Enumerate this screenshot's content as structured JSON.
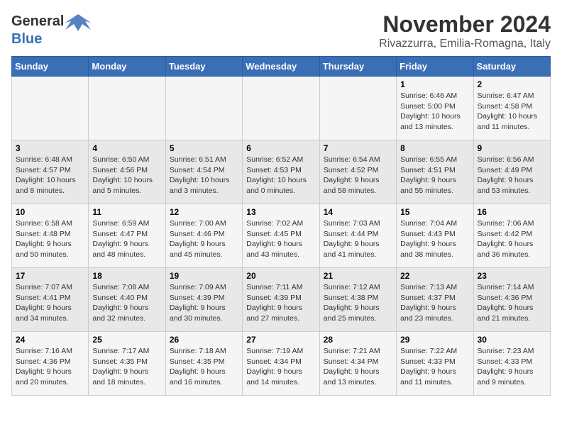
{
  "header": {
    "logo_general": "General",
    "logo_blue": "Blue",
    "month_title": "November 2024",
    "location": "Rivazzurra, Emilia-Romagna, Italy"
  },
  "days_of_week": [
    "Sunday",
    "Monday",
    "Tuesday",
    "Wednesday",
    "Thursday",
    "Friday",
    "Saturday"
  ],
  "weeks": [
    {
      "days": [
        {
          "num": "",
          "info": ""
        },
        {
          "num": "",
          "info": ""
        },
        {
          "num": "",
          "info": ""
        },
        {
          "num": "",
          "info": ""
        },
        {
          "num": "",
          "info": ""
        },
        {
          "num": "1",
          "info": "Sunrise: 6:46 AM\nSunset: 5:00 PM\nDaylight: 10 hours and 13 minutes."
        },
        {
          "num": "2",
          "info": "Sunrise: 6:47 AM\nSunset: 4:58 PM\nDaylight: 10 hours and 11 minutes."
        }
      ]
    },
    {
      "days": [
        {
          "num": "3",
          "info": "Sunrise: 6:48 AM\nSunset: 4:57 PM\nDaylight: 10 hours and 8 minutes."
        },
        {
          "num": "4",
          "info": "Sunrise: 6:50 AM\nSunset: 4:56 PM\nDaylight: 10 hours and 5 minutes."
        },
        {
          "num": "5",
          "info": "Sunrise: 6:51 AM\nSunset: 4:54 PM\nDaylight: 10 hours and 3 minutes."
        },
        {
          "num": "6",
          "info": "Sunrise: 6:52 AM\nSunset: 4:53 PM\nDaylight: 10 hours and 0 minutes."
        },
        {
          "num": "7",
          "info": "Sunrise: 6:54 AM\nSunset: 4:52 PM\nDaylight: 9 hours and 58 minutes."
        },
        {
          "num": "8",
          "info": "Sunrise: 6:55 AM\nSunset: 4:51 PM\nDaylight: 9 hours and 55 minutes."
        },
        {
          "num": "9",
          "info": "Sunrise: 6:56 AM\nSunset: 4:49 PM\nDaylight: 9 hours and 53 minutes."
        }
      ]
    },
    {
      "days": [
        {
          "num": "10",
          "info": "Sunrise: 6:58 AM\nSunset: 4:48 PM\nDaylight: 9 hours and 50 minutes."
        },
        {
          "num": "11",
          "info": "Sunrise: 6:59 AM\nSunset: 4:47 PM\nDaylight: 9 hours and 48 minutes."
        },
        {
          "num": "12",
          "info": "Sunrise: 7:00 AM\nSunset: 4:46 PM\nDaylight: 9 hours and 45 minutes."
        },
        {
          "num": "13",
          "info": "Sunrise: 7:02 AM\nSunset: 4:45 PM\nDaylight: 9 hours and 43 minutes."
        },
        {
          "num": "14",
          "info": "Sunrise: 7:03 AM\nSunset: 4:44 PM\nDaylight: 9 hours and 41 minutes."
        },
        {
          "num": "15",
          "info": "Sunrise: 7:04 AM\nSunset: 4:43 PM\nDaylight: 9 hours and 38 minutes."
        },
        {
          "num": "16",
          "info": "Sunrise: 7:06 AM\nSunset: 4:42 PM\nDaylight: 9 hours and 36 minutes."
        }
      ]
    },
    {
      "days": [
        {
          "num": "17",
          "info": "Sunrise: 7:07 AM\nSunset: 4:41 PM\nDaylight: 9 hours and 34 minutes."
        },
        {
          "num": "18",
          "info": "Sunrise: 7:08 AM\nSunset: 4:40 PM\nDaylight: 9 hours and 32 minutes."
        },
        {
          "num": "19",
          "info": "Sunrise: 7:09 AM\nSunset: 4:39 PM\nDaylight: 9 hours and 30 minutes."
        },
        {
          "num": "20",
          "info": "Sunrise: 7:11 AM\nSunset: 4:39 PM\nDaylight: 9 hours and 27 minutes."
        },
        {
          "num": "21",
          "info": "Sunrise: 7:12 AM\nSunset: 4:38 PM\nDaylight: 9 hours and 25 minutes."
        },
        {
          "num": "22",
          "info": "Sunrise: 7:13 AM\nSunset: 4:37 PM\nDaylight: 9 hours and 23 minutes."
        },
        {
          "num": "23",
          "info": "Sunrise: 7:14 AM\nSunset: 4:36 PM\nDaylight: 9 hours and 21 minutes."
        }
      ]
    },
    {
      "days": [
        {
          "num": "24",
          "info": "Sunrise: 7:16 AM\nSunset: 4:36 PM\nDaylight: 9 hours and 20 minutes."
        },
        {
          "num": "25",
          "info": "Sunrise: 7:17 AM\nSunset: 4:35 PM\nDaylight: 9 hours and 18 minutes."
        },
        {
          "num": "26",
          "info": "Sunrise: 7:18 AM\nSunset: 4:35 PM\nDaylight: 9 hours and 16 minutes."
        },
        {
          "num": "27",
          "info": "Sunrise: 7:19 AM\nSunset: 4:34 PM\nDaylight: 9 hours and 14 minutes."
        },
        {
          "num": "28",
          "info": "Sunrise: 7:21 AM\nSunset: 4:34 PM\nDaylight: 9 hours and 13 minutes."
        },
        {
          "num": "29",
          "info": "Sunrise: 7:22 AM\nSunset: 4:33 PM\nDaylight: 9 hours and 11 minutes."
        },
        {
          "num": "30",
          "info": "Sunrise: 7:23 AM\nSunset: 4:33 PM\nDaylight: 9 hours and 9 minutes."
        }
      ]
    }
  ]
}
